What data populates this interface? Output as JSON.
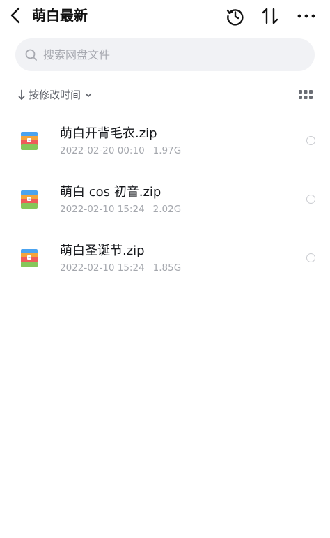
{
  "header": {
    "title": "萌白最新",
    "back_icon": "chevron-left-icon",
    "history_icon": "history-icon",
    "sort_icon": "sort-arrows-icon",
    "more_icon": "more-dots-icon"
  },
  "search": {
    "placeholder": "搜索网盘文件",
    "icon": "search-icon"
  },
  "sort": {
    "label": "按修改时间",
    "direction_icon": "arrow-down-icon",
    "dropdown_icon": "chevron-down-icon",
    "view_toggle_icon": "grid-view-icon"
  },
  "files": [
    {
      "name": "萌白开背毛衣.zip",
      "date": "2022-02-20 00:10",
      "size": "1.97G",
      "icon": "zip-archive-icon"
    },
    {
      "name": "萌白 cos 初音.zip",
      "date": "2022-02-10 15:24",
      "size": "2.02G",
      "icon": "zip-archive-icon"
    },
    {
      "name": "萌白圣诞节.zip",
      "date": "2022-02-10 15:24",
      "size": "1.85G",
      "icon": "zip-archive-icon"
    }
  ],
  "colors": {
    "zip_blue": "#4aa3f0",
    "zip_orange": "#f4a43c",
    "zip_red": "#ef5b5b",
    "zip_green": "#86c75a",
    "zip_clasp": "#ffffff"
  }
}
